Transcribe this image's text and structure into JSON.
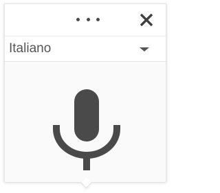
{
  "toolbar": {
    "more_icon": "more-horizontal-icon",
    "close_icon": "close-icon"
  },
  "language": {
    "selected": "Italiano",
    "dropdown_icon": "caret-down-icon"
  },
  "voice": {
    "icon": "microphone-icon",
    "icon_color": "#4a4a4a"
  }
}
